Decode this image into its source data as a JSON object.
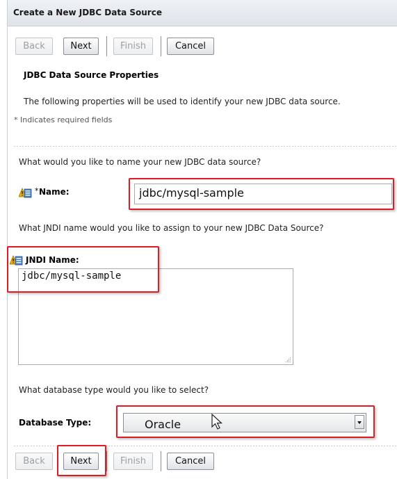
{
  "window": {
    "title": "Create a New JDBC Data Source"
  },
  "toolbar": {
    "back": "Back",
    "next": "Next",
    "finish": "Finish",
    "cancel": "Cancel"
  },
  "section": {
    "title": "JDBC Data Source Properties",
    "description": "The following properties will be used to identify your new JDBC data source.",
    "required_note": "* Indicates required fields"
  },
  "name_field": {
    "question": "What would you like to name your new JDBC data source?",
    "required_marker": "*",
    "label": "Name:",
    "value": "jdbc/mysql-sample",
    "icon": "warning-icon"
  },
  "jndi_field": {
    "question": "What JNDI name would you like to assign to your new JDBC Data Source?",
    "label": "JNDI Name:",
    "value": "jdbc/mysql-sample",
    "icon": "warning-icon"
  },
  "db_type": {
    "question": "What database type would you like to select?",
    "label": "Database Type:",
    "selected": "Oracle"
  },
  "colors": {
    "highlight": "#e01b24",
    "header_bg": "#e5e9ee"
  }
}
